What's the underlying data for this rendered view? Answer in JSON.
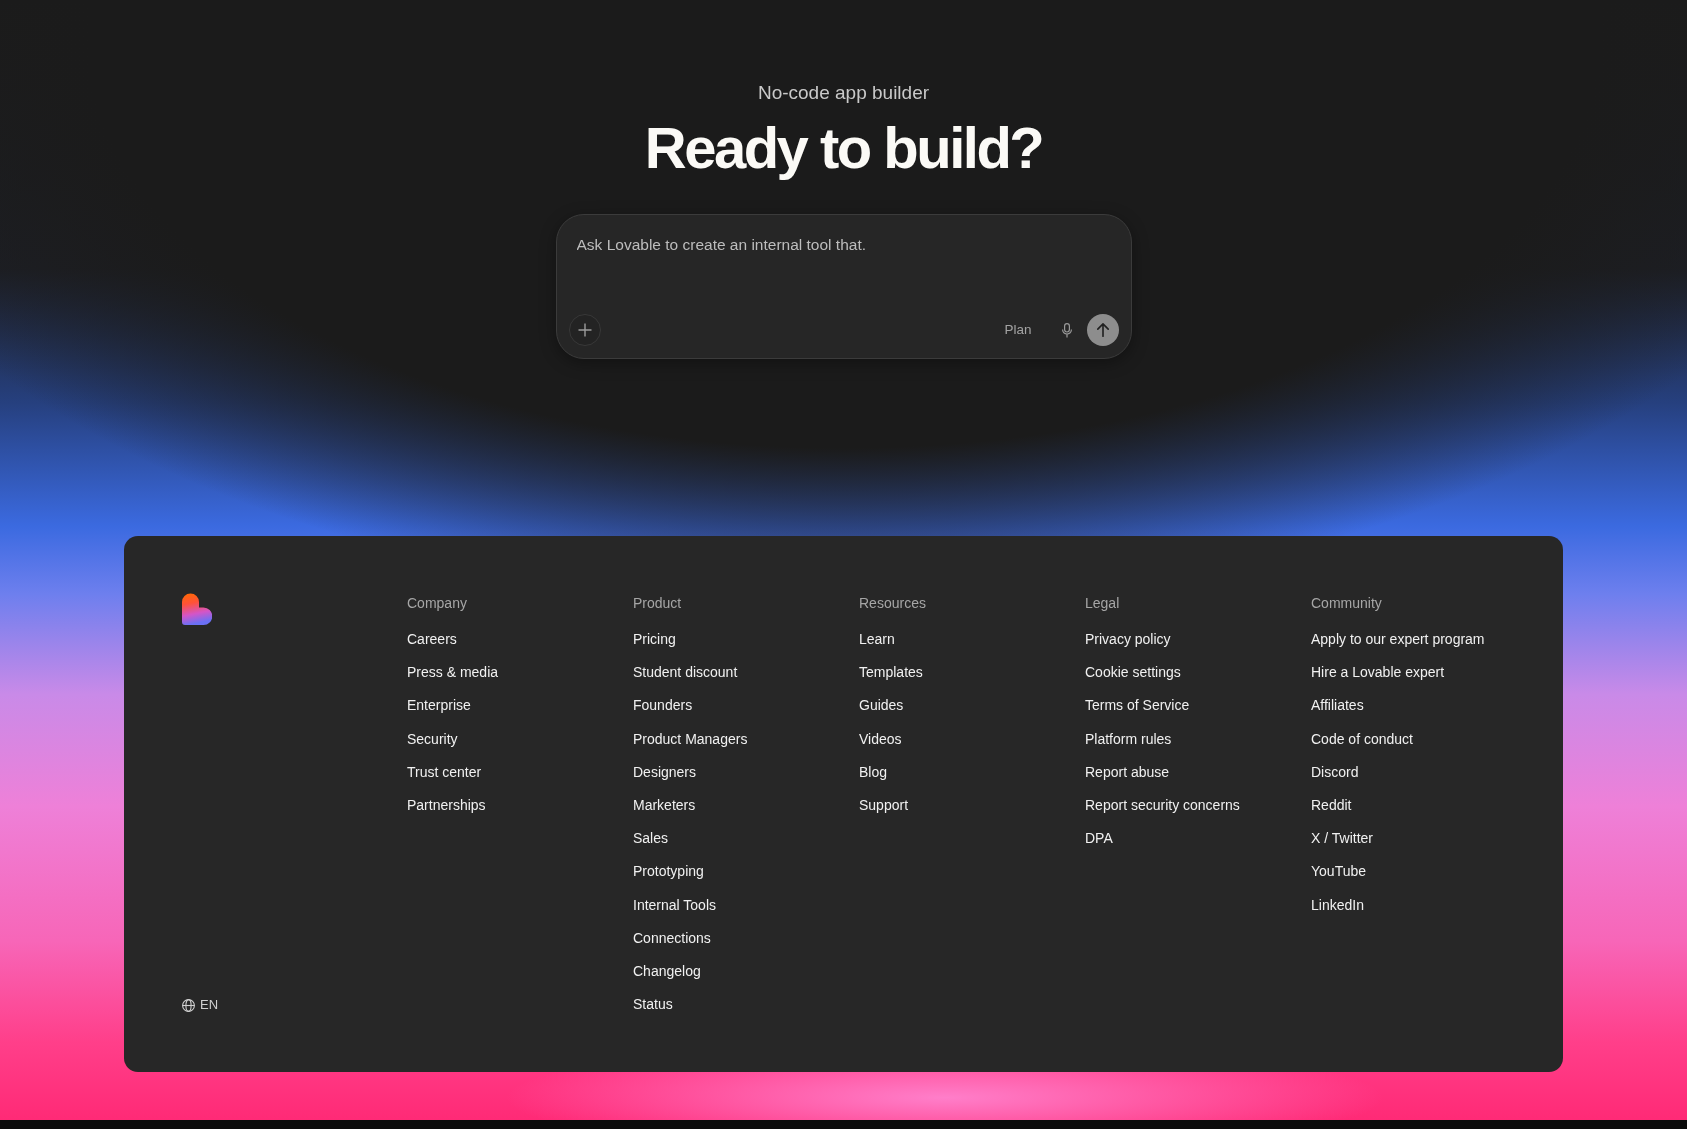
{
  "hero": {
    "subtitle": "No-code app builder",
    "title": "Ready to build?"
  },
  "prompt": {
    "placeholder": "Ask Lovable to create an internal tool that.",
    "mode_button": "Plan",
    "send_button": {
      "disabled": true
    }
  },
  "footer": {
    "columns": [
      {
        "heading": "Company",
        "links": [
          "Careers",
          "Press & media",
          "Enterprise",
          "Security",
          "Trust center",
          "Partnerships"
        ]
      },
      {
        "heading": "Product",
        "links": [
          "Pricing",
          "Student discount",
          "Founders",
          "Product Managers",
          "Designers",
          "Marketers",
          "Sales",
          "Prototyping",
          "Internal Tools",
          "Connections",
          "Changelog",
          "Status"
        ]
      },
      {
        "heading": "Resources",
        "links": [
          "Learn",
          "Templates",
          "Guides",
          "Videos",
          "Blog",
          "Support"
        ]
      },
      {
        "heading": "Legal",
        "links": [
          "Privacy policy",
          "Cookie settings",
          "Terms of Service",
          "Platform rules",
          "Report abuse",
          "Report security concerns",
          "DPA"
        ]
      },
      {
        "heading": "Community",
        "links": [
          "Apply to our expert program",
          "Hire a Lovable expert",
          "Affiliates",
          "Code of conduct",
          "Discord",
          "Reddit",
          "X / Twitter",
          "YouTube",
          "LinkedIn"
        ]
      }
    ],
    "language": "EN"
  }
}
